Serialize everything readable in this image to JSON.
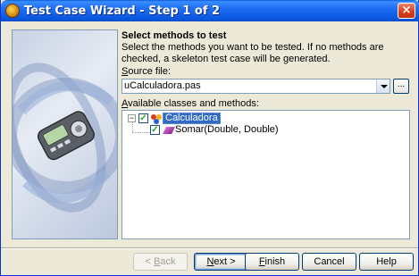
{
  "window": {
    "title": "Test Case Wizard - Step 1 of 2",
    "close_glyph": "×",
    "title_icon": "wizard-app-icon"
  },
  "page": {
    "heading": "Select methods to test",
    "description": "Select the methods you want to be tested.  If no methods are checked, a skeleton test case will be generated."
  },
  "source_file": {
    "label_mnemonic": "S",
    "label_rest": "ource file:",
    "value": "uCalculadora.pas",
    "browse_label": "..."
  },
  "tree": {
    "label_mnemonic": "A",
    "label_rest": "vailable classes and methods:",
    "items": [
      {
        "label": "Calculadora",
        "checked": true,
        "expanded": true,
        "selected": true,
        "icon": "class-icon"
      },
      {
        "label": "Somar(Double, Double)",
        "checked": true,
        "selected": false,
        "icon": "method-icon"
      }
    ]
  },
  "buttons": {
    "back": {
      "mnemonic": "B",
      "prefix": "< ",
      "rest": "ack"
    },
    "next": {
      "mnemonic": "N",
      "rest": "ext >"
    },
    "finish": {
      "mnemonic": "F",
      "rest": "inish"
    },
    "cancel": "Cancel",
    "help": "Help"
  },
  "colors": {
    "title_bar": "#0b58e0",
    "selection": "#316ac5",
    "dialog_bg": "#ece9d8"
  }
}
